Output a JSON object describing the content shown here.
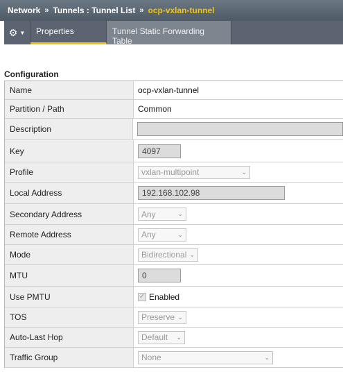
{
  "breadcrumb": {
    "section": "Network",
    "sep1": "»",
    "list": "Tunnels : Tunnel List",
    "sep2": "»",
    "current": "ocp-vxlan-tunnel"
  },
  "toolbar": {
    "gear_icon": "gear-icon",
    "caret_icon": "chevron-down-icon"
  },
  "tabs": [
    {
      "label": "Properties",
      "active": true
    },
    {
      "label": "Tunnel Static Forwarding Table",
      "active": false
    }
  ],
  "configuration": {
    "title": "Configuration",
    "rows": {
      "name": {
        "label": "Name",
        "value": "ocp-vxlan-tunnel"
      },
      "partition": {
        "label": "Partition / Path",
        "value": "Common"
      },
      "description": {
        "label": "Description",
        "value": ""
      },
      "key": {
        "label": "Key",
        "value": "4097"
      },
      "profile": {
        "label": "Profile",
        "value": "vxlan-multipoint"
      },
      "local_address": {
        "label": "Local Address",
        "value": "192.168.102.98"
      },
      "secondary_address": {
        "label": "Secondary Address",
        "value": "Any"
      },
      "remote_address": {
        "label": "Remote Address",
        "value": "Any"
      },
      "mode": {
        "label": "Mode",
        "value": "Bidirectional"
      },
      "mtu": {
        "label": "MTU",
        "value": "0"
      },
      "use_pmtu": {
        "label": "Use PMTU",
        "checked": true,
        "value": "Enabled"
      },
      "tos": {
        "label": "TOS",
        "value": "Preserve"
      },
      "auto_last_hop": {
        "label": "Auto-Last Hop",
        "value": "Default"
      },
      "traffic_group": {
        "label": "Traffic Group",
        "value": "None"
      }
    }
  },
  "colors": {
    "breadcrumb_current": "#f5c400",
    "tab_active_underline": "#f5c400",
    "header_bg": "#4f5a67",
    "label_bg": "#eeeeee"
  }
}
